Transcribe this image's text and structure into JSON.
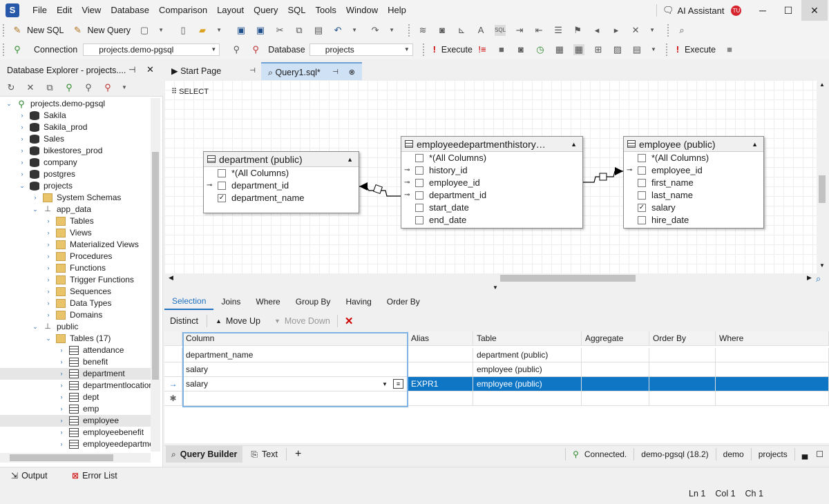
{
  "app": {
    "logo": "S"
  },
  "menu": [
    "File",
    "Edit",
    "View",
    "Database",
    "Comparison",
    "Layout",
    "Query",
    "SQL",
    "Tools",
    "Window",
    "Help"
  ],
  "ai_assistant": {
    "label": "AI Assistant",
    "user_initials": "TU"
  },
  "window_controls": {
    "minimize": "─",
    "maximize": "☐",
    "close": "✕"
  },
  "toolbar1": {
    "new_sql": "New SQL",
    "new_query": "New Query"
  },
  "toolbar2": {
    "connection_label": "Connection",
    "connection_value": "projects.demo-pgsql",
    "database_label": "Database",
    "database_value": "projects",
    "execute": "Execute",
    "execute2": "Execute"
  },
  "explorer": {
    "title": "Database Explorer - projects....",
    "tree": [
      {
        "label": "projects.demo-pgsql",
        "level": 0,
        "icon": "conn",
        "caret": "v"
      },
      {
        "label": "Sakila",
        "level": 1,
        "icon": "db",
        "caret": ">"
      },
      {
        "label": "Sakila_prod",
        "level": 1,
        "icon": "db",
        "caret": ">"
      },
      {
        "label": "Sales",
        "level": 1,
        "icon": "db",
        "caret": ">"
      },
      {
        "label": "bikestores_prod",
        "level": 1,
        "icon": "db",
        "caret": ">"
      },
      {
        "label": "company",
        "level": 1,
        "icon": "db",
        "caret": ">"
      },
      {
        "label": "postgres",
        "level": 1,
        "icon": "db",
        "caret": ">"
      },
      {
        "label": "projects",
        "level": 1,
        "icon": "db",
        "caret": "v"
      },
      {
        "label": "System Schemas",
        "level": 2,
        "icon": "folder",
        "caret": ">"
      },
      {
        "label": "app_data",
        "level": 2,
        "icon": "schema",
        "caret": "v"
      },
      {
        "label": "Tables",
        "level": 3,
        "icon": "folder",
        "caret": ">"
      },
      {
        "label": "Views",
        "level": 3,
        "icon": "folder",
        "caret": ">"
      },
      {
        "label": "Materialized Views",
        "level": 3,
        "icon": "folder",
        "caret": ">"
      },
      {
        "label": "Procedures",
        "level": 3,
        "icon": "folder",
        "caret": ">"
      },
      {
        "label": "Functions",
        "level": 3,
        "icon": "folder",
        "caret": ">"
      },
      {
        "label": "Trigger Functions",
        "level": 3,
        "icon": "folder",
        "caret": ">"
      },
      {
        "label": "Sequences",
        "level": 3,
        "icon": "folder",
        "caret": ">"
      },
      {
        "label": "Data Types",
        "level": 3,
        "icon": "folder",
        "caret": ">"
      },
      {
        "label": "Domains",
        "level": 3,
        "icon": "folder",
        "caret": ">"
      },
      {
        "label": "public",
        "level": 2,
        "icon": "schema",
        "caret": "v"
      },
      {
        "label": "Tables (17)",
        "level": 3,
        "icon": "folder",
        "caret": "v"
      },
      {
        "label": "attendance",
        "level": 4,
        "icon": "table",
        "caret": ">"
      },
      {
        "label": "benefit",
        "level": 4,
        "icon": "table",
        "caret": ">"
      },
      {
        "label": "department",
        "level": 4,
        "icon": "table",
        "caret": ">",
        "selected": true
      },
      {
        "label": "departmentlocation",
        "level": 4,
        "icon": "table",
        "caret": ">"
      },
      {
        "label": "dept",
        "level": 4,
        "icon": "table",
        "caret": ">"
      },
      {
        "label": "emp",
        "level": 4,
        "icon": "table",
        "caret": ">"
      },
      {
        "label": "employee",
        "level": 4,
        "icon": "table",
        "caret": ">",
        "selected": true
      },
      {
        "label": "employeebenefit",
        "level": 4,
        "icon": "table",
        "caret": ">"
      },
      {
        "label": "employeedepartmer",
        "level": 4,
        "icon": "table",
        "caret": ">"
      }
    ]
  },
  "tabs": [
    {
      "label": "Start Page",
      "active": false
    },
    {
      "label": "Query1.sql*",
      "active": true
    }
  ],
  "sql_keyword": "SELECT",
  "diagram": {
    "department": {
      "title": "department (public)",
      "fields": [
        {
          "name": "*(All Columns)",
          "checked": false,
          "key": false
        },
        {
          "name": "department_id",
          "checked": false,
          "key": true
        },
        {
          "name": "department_name",
          "checked": true,
          "key": false
        }
      ]
    },
    "history": {
      "title": "employeedepartmenthistory…",
      "fields": [
        {
          "name": "*(All Columns)",
          "checked": false,
          "key": false
        },
        {
          "name": "history_id",
          "checked": false,
          "key": true
        },
        {
          "name": "employee_id",
          "checked": false,
          "key": "fk"
        },
        {
          "name": "department_id",
          "checked": false,
          "key": "fk"
        },
        {
          "name": "start_date",
          "checked": false,
          "key": false
        },
        {
          "name": "end_date",
          "checked": false,
          "key": false
        }
      ]
    },
    "employee": {
      "title": "employee (public)",
      "fields": [
        {
          "name": "*(All Columns)",
          "checked": false,
          "key": false
        },
        {
          "name": "employee_id",
          "checked": false,
          "key": true
        },
        {
          "name": "first_name",
          "checked": false,
          "key": false
        },
        {
          "name": "last_name",
          "checked": false,
          "key": false
        },
        {
          "name": "salary",
          "checked": true,
          "key": false
        },
        {
          "name": "hire_date",
          "checked": false,
          "key": false
        }
      ]
    }
  },
  "bottom_tabs": [
    "Selection",
    "Joins",
    "Where",
    "Group By",
    "Having",
    "Order By"
  ],
  "selection_toolbar": {
    "distinct": "Distinct",
    "move_up": "Move Up",
    "move_down": "Move Down"
  },
  "grid": {
    "headers": [
      "Column",
      "Alias",
      "Table",
      "Aggregate",
      "Order By",
      "Where"
    ],
    "rows": [
      [
        "department_name",
        "",
        "department (public)",
        "",
        "",
        ""
      ],
      [
        "salary",
        "",
        "employee (public)",
        "",
        "",
        ""
      ],
      [
        "salary",
        "EXPR1",
        "employee (public)",
        "",
        "",
        ""
      ]
    ]
  },
  "query_bar": {
    "builder": "Query Builder",
    "text": "Text",
    "add": "+",
    "status": "Connected.",
    "server": "demo-pgsql (18.2)",
    "user": "demo",
    "db": "projects"
  },
  "statusbar": {
    "output": "Output",
    "errors": "Error List",
    "ln": "Ln 1",
    "col": "Col 1",
    "ch": "Ch 1"
  }
}
